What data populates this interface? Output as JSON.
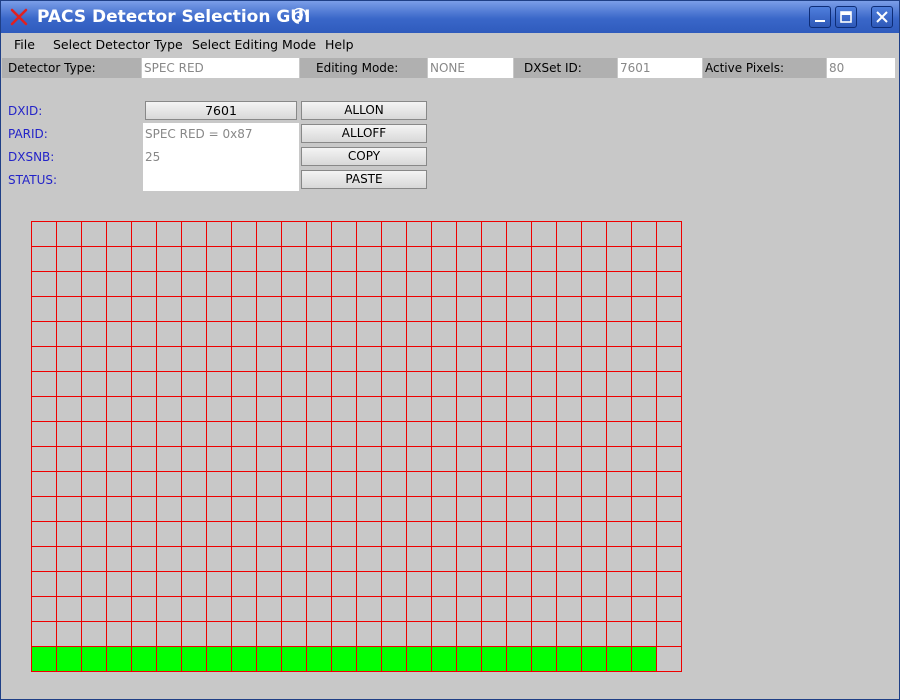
{
  "window": {
    "title": "PACS Detector Selection GUI",
    "app_icon": "red-x-icon",
    "controls": [
      "minimize-icon",
      "maximize-icon",
      "close-icon"
    ]
  },
  "menu": [
    {
      "label": "File"
    },
    {
      "label": "Select Detector Type"
    },
    {
      "label": "Select Editing Mode"
    },
    {
      "label": "Help"
    }
  ],
  "info": {
    "detector_type_label": "Detector Type:",
    "detector_type_value": "SPEC RED",
    "editing_mode_label": "Editing Mode:",
    "editing_mode_value": "NONE",
    "dxset_label": "DXSet ID:",
    "dxset_value": "7601",
    "active_label": "Active Pixels:",
    "active_value": "80"
  },
  "details": {
    "dxid_label": "DXID:",
    "parid_label": "PARID:",
    "dxsnb_label": "DXSNB:",
    "status_label": "STATUS:",
    "dxid_value": "7601",
    "parid_value": "SPEC RED = 0x87",
    "dxsnb_value": "25",
    "status_value": ""
  },
  "actions": {
    "allon": "ALLON",
    "alloff": "ALLOFF",
    "copy": "COPY",
    "paste": "PASTE"
  },
  "grid": {
    "columns": 26,
    "rows": 18,
    "active_row": 17,
    "active_count": 25,
    "line_color": "#ee0000",
    "on_color": "#00ff00",
    "off_color": "#c8c8c8"
  }
}
